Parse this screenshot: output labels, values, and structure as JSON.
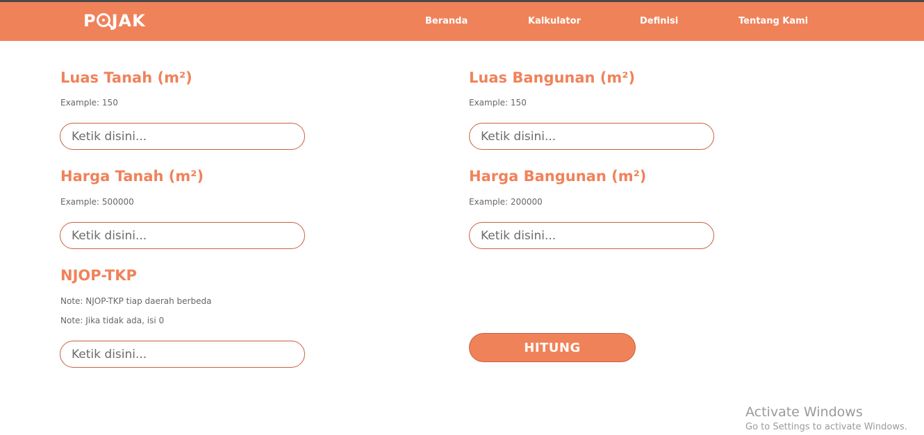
{
  "brand": {
    "logo_text_pre": "P",
    "logo_text_post": "JAK",
    "color": "#F0825A"
  },
  "nav": {
    "items": [
      {
        "label": "Beranda"
      },
      {
        "label": "Kalkulator"
      },
      {
        "label": "Definisi"
      },
      {
        "label": "Tentang Kami"
      }
    ]
  },
  "form": {
    "luas_tanah": {
      "title": "Luas Tanah (m²)",
      "hint": "Example: 150",
      "placeholder": "Ketik disini...",
      "value": ""
    },
    "luas_bangunan": {
      "title": "Luas Bangunan (m²)",
      "hint": "Example: 150",
      "placeholder": "Ketik disini...",
      "value": ""
    },
    "harga_tanah": {
      "title": "Harga Tanah (m²)",
      "hint": "Example: 500000",
      "placeholder": "Ketik disini...",
      "value": ""
    },
    "harga_bangunan": {
      "title": "Harga Bangunan (m²)",
      "hint": "Example: 200000",
      "placeholder": "Ketik disini...",
      "value": ""
    },
    "njop_tkp": {
      "title": "NJOP-TKP",
      "note_1": "Note: NJOP-TKP tiap daerah berbeda",
      "note_2": "Note: Jika tidak ada, isi 0",
      "placeholder": "Ketik disini...",
      "value": ""
    },
    "submit_label": "HITUNG"
  },
  "watermark": {
    "title": "Activate Windows",
    "subtitle": "Go to Settings to activate Windows."
  }
}
